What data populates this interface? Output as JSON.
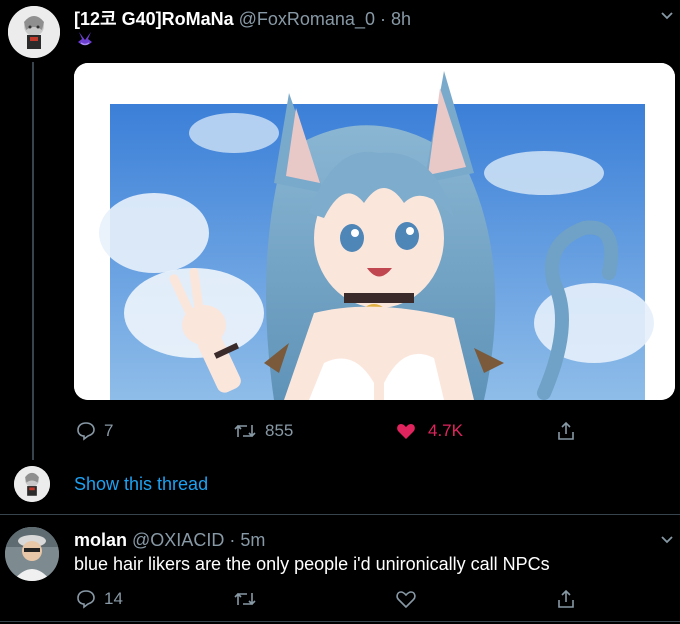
{
  "tweet1": {
    "display_name": "[12코 G40]RoMaNa",
    "handle": "@FoxRomana_0",
    "separator": "·",
    "time": "8h",
    "replies": "7",
    "retweets": "855",
    "likes": "4.7K",
    "like_color": "#e0245e"
  },
  "thread": {
    "show_label": "Show this thread"
  },
  "tweet2": {
    "display_name": "molan",
    "handle": "@OXIACID",
    "separator": "·",
    "time": "5m",
    "text": "blue hair likers are the only people i'd unironically call NPCs",
    "replies": "14"
  },
  "colors": {
    "background": "#000000",
    "link": "#1da1f2",
    "muted": "#8899a6",
    "divider": "#38444d"
  },
  "icons": [
    "reply-icon",
    "retweet-icon",
    "like-icon",
    "share-icon",
    "chevron-down-icon",
    "purple-emblem-icon"
  ]
}
